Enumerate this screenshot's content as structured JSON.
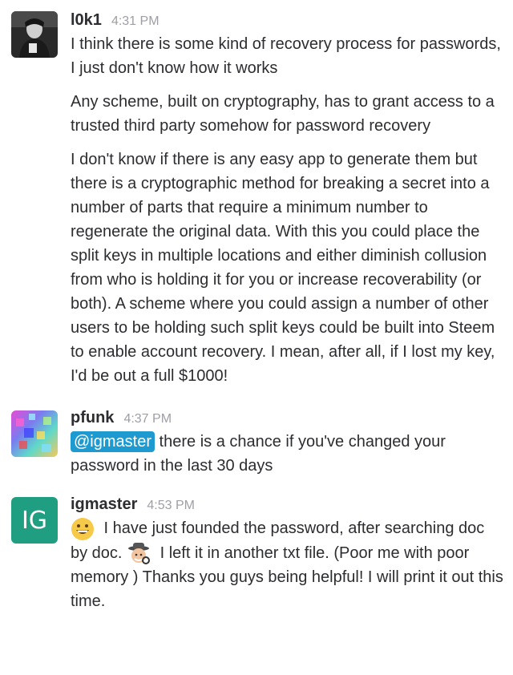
{
  "messages": [
    {
      "author": "l0k1",
      "time": "4:31 PM",
      "avatar_icon": "user-photo-dark",
      "paragraphs": [
        "I think there is some kind of recovery process for passwords, I just don't know how it works",
        "Any scheme, built on cryptography, has to grant access to a trusted third party somehow for password recovery",
        "I don't know if there is any easy app to generate them but there is a cryptographic method for breaking a secret into a number of parts that require a minimum number to regenerate the original data. With this you could place the split keys in multiple locations and either diminish collusion from who is holding it for you or increase recoverability (or both). A scheme where you could assign a number of other users to be holding such split keys could be built into Steem to enable account recovery. I mean, after all, if I lost my key, I'd be out a full $1000!"
      ]
    },
    {
      "author": "pfunk",
      "time": "4:37 PM",
      "avatar_icon": "colorful-pixel-avatar",
      "mention": "@igmaster",
      "text": " there is a chance if you've changed your password in the last 30 days"
    },
    {
      "author": "igmaster",
      "time": "4:53 PM",
      "avatar_initials": "IG",
      "avatar_color": "#1f9e82",
      "emoji_1": "grinning-face-emoji",
      "text_1": " I have just founded the password, after searching doc by doc. ",
      "emoji_2": "detective-emoji",
      "text_2": " I left it in another txt file. (Poor me with poor memory ) Thanks you guys being helpful! I will print it out this time."
    }
  ]
}
